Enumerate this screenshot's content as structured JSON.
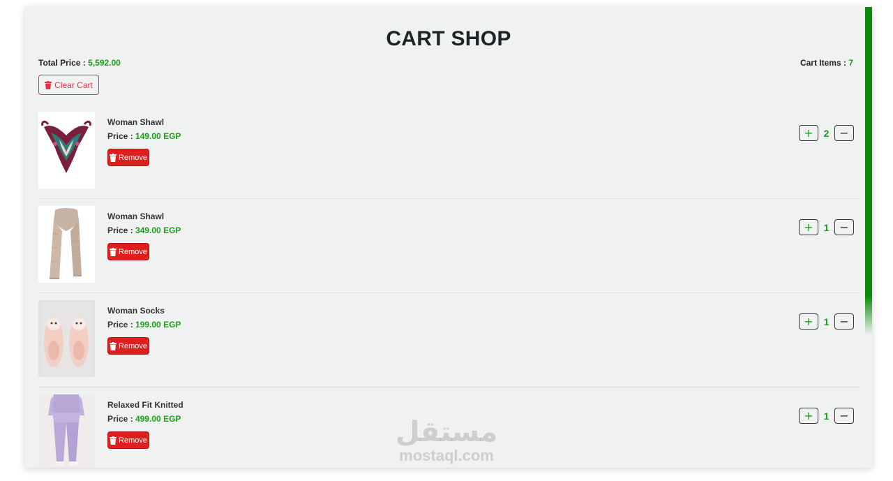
{
  "page": {
    "title": "CART SHOP",
    "total_label": "Total Price : ",
    "total_value": "5,592.00",
    "items_label": "Cart Items : ",
    "items_value": "7",
    "clear_label": "Clear Cart"
  },
  "items": [
    {
      "name": "Woman Shawl",
      "price_label": "Price : ",
      "price": "149.00 EGP",
      "remove_label": "Remove",
      "quantity": "2",
      "plus": "+",
      "minus": "−",
      "image": "printed-silk-shawl"
    },
    {
      "name": "Woman Shawl",
      "price_label": "Price : ",
      "price": "349.00 EGP",
      "remove_label": "Remove",
      "quantity": "1",
      "plus": "+",
      "minus": "−",
      "image": "beige-knit-scarf"
    },
    {
      "name": "Woman Socks",
      "price_label": "Price : ",
      "price": "199.00 EGP",
      "remove_label": "Remove",
      "quantity": "1",
      "plus": "+",
      "minus": "−",
      "image": "pink-fluffy-socks"
    },
    {
      "name": "Relaxed Fit Knitted",
      "price_label": "Price : ",
      "price": "499.00 EGP",
      "remove_label": "Remove",
      "quantity": "1",
      "plus": "+",
      "minus": "−",
      "image": "lilac-knit-set"
    }
  ],
  "watermark": {
    "arabic": "مستقل",
    "latin": "mostaql.com"
  },
  "colors": {
    "accent_green": "#1a9e1a",
    "danger_red": "#dd1f1f",
    "side_bar": "#0c8a0c",
    "card_bg": "#f0f2f1"
  }
}
